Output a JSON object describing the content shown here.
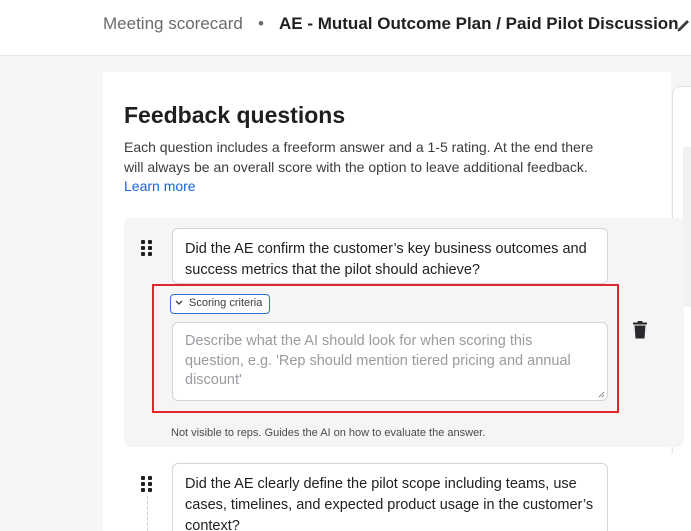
{
  "header": {
    "breadcrumb_parent": "Meeting scorecard",
    "separator": "•",
    "title": "AE - Mutual Outcome Plan / Paid Pilot Discussion",
    "edit_icon": "pencil-icon"
  },
  "section": {
    "title": "Feedback questions",
    "description": "Each question includes a freeform answer and a 1-5 rating. At the end there will always be an overall score with the option to leave additional feedback.",
    "learn_more": "Learn more"
  },
  "questions": [
    {
      "text": "Did the AE confirm the customer’s key business outcomes and success metrics that the pilot should achieve?",
      "criteria_toggle": "Scoring criteria",
      "criteria_placeholder": "Describe what the AI should look for when scoring this question, e.g. 'Rep should mention tiered pricing and annual discount'",
      "criteria_value": "",
      "criteria_note": "Not visible to reps. Guides the AI on how to evaluate the answer.",
      "icons": [
        "drag-handle-icon",
        "chevron-down-icon",
        "trash-icon"
      ]
    },
    {
      "text": "Did the AE clearly define the pilot scope including teams, use cases, timelines, and expected product usage in the customer’s context?",
      "icons": [
        "drag-handle-icon"
      ]
    }
  ],
  "colors": {
    "accent": "#2f6fd6",
    "link": "#1a62d6",
    "highlight": "#e0262b"
  }
}
